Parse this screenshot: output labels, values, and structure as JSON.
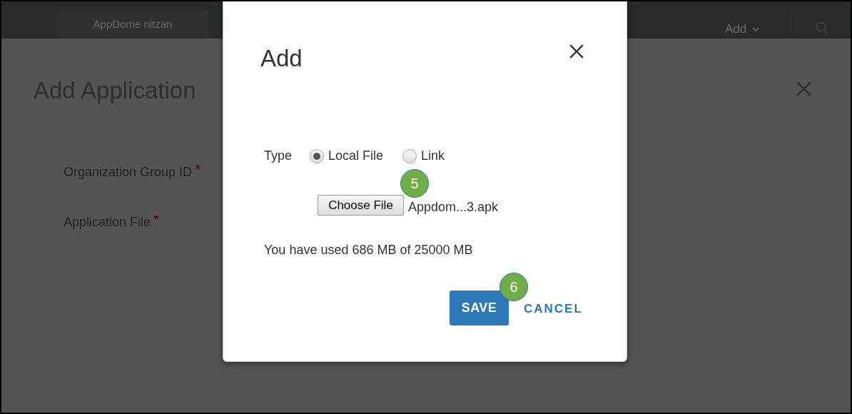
{
  "header": {
    "tab": "AppDome nitzan",
    "add_menu": "Add"
  },
  "background_panel": {
    "title": "Add Application",
    "fields": [
      {
        "label": "Organization Group ID",
        "required": true,
        "required_mark": "*"
      },
      {
        "label": "Application File",
        "required": true,
        "required_mark": "*"
      }
    ]
  },
  "dialog": {
    "title": "Add",
    "type_label": "Type",
    "type_options": [
      {
        "label": "Local File",
        "selected": true
      },
      {
        "label": "Link",
        "selected": false
      }
    ],
    "file_button": "Choose File",
    "file_name": "Appdom...3.apk",
    "usage": "You have used 686 MB of 25000 MB",
    "buttons": [
      {
        "kind": "primary",
        "label": "SAVE"
      },
      {
        "kind": "link",
        "label": "CANCEL"
      }
    ]
  },
  "callouts": [
    {
      "label": "5"
    },
    {
      "label": "6"
    }
  ]
}
